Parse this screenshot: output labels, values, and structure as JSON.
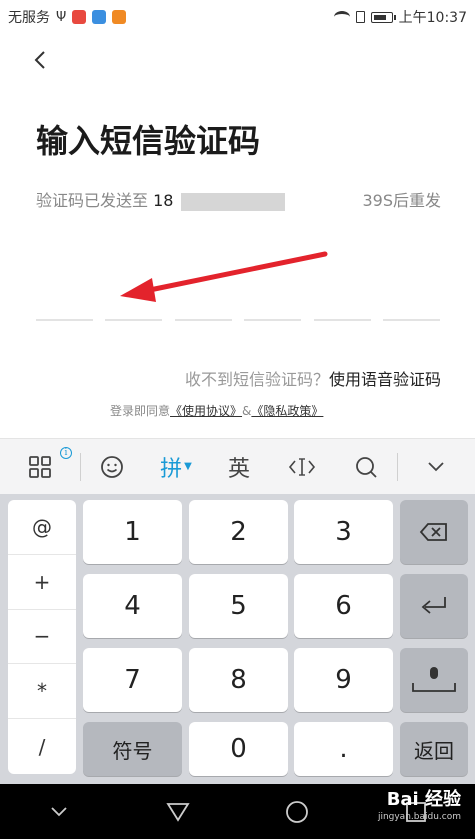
{
  "status_bar": {
    "carrier": "无服务",
    "time": "上午10:37"
  },
  "page": {
    "title": "输入短信验证码",
    "sent_label": "验证码已发送至",
    "phone_prefix": "18",
    "resend_countdown": "39S后重发",
    "no_sms_text": "收不到短信验证码？",
    "voice_link": "使用语音验证码",
    "agreement_prefix": "登录即同意",
    "terms_link": "《使用协议》",
    "amp": "&",
    "privacy_link": "《隐私政策》"
  },
  "ime_toolbar": {
    "pinyin_label": "拼",
    "english_label": "英"
  },
  "keyboard": {
    "symbols": [
      "@",
      "+",
      "−",
      "*",
      "/"
    ],
    "keys": {
      "k1": "1",
      "k2": "2",
      "k3": "3",
      "k4": "4",
      "k5": "5",
      "k6": "6",
      "k7": "7",
      "k8": "8",
      "k9": "9",
      "k0": "0",
      "dot": ".",
      "symbol_key": "符号",
      "return_key": "返回"
    }
  },
  "watermark": {
    "brand": "Bai 经验",
    "url": "jingyan.baidu.com"
  },
  "colors": {
    "accent": "#1a9ad6",
    "arrow": "#e3232c",
    "keyboard_bg": "#d4d6db"
  }
}
